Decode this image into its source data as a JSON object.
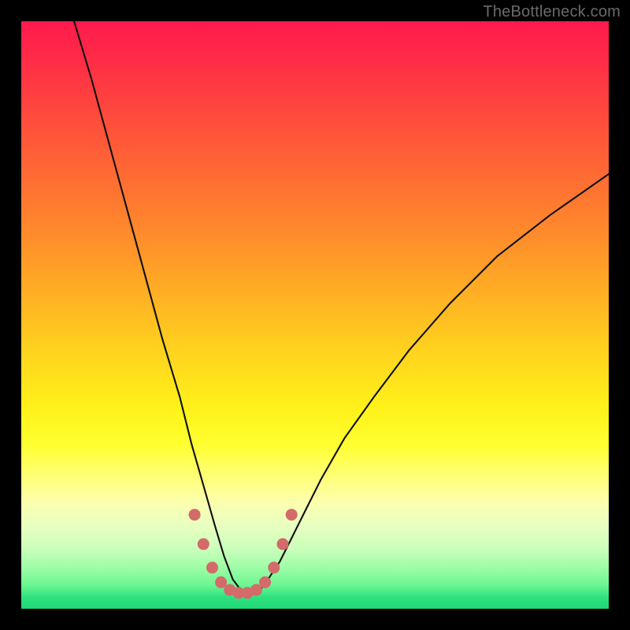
{
  "watermark": {
    "text": "TheBottleneck.com"
  },
  "colors": {
    "frame": "#000000",
    "curve_stroke": "#0f0f0f",
    "marker_fill": "#d46a6a",
    "gradient_stops": [
      "#ff1a4d",
      "#ff2a47",
      "#ff4a3d",
      "#ff6a33",
      "#ff8a2b",
      "#ffae24",
      "#ffd21e",
      "#fff21a",
      "#ffff30",
      "#ffff7d",
      "#fbffb0",
      "#e7ffc0",
      "#c8ffba",
      "#9dfda6",
      "#6cf591",
      "#2fe27e",
      "#1fd877"
    ]
  },
  "chart_data": {
    "type": "line",
    "title": "",
    "xlabel": "",
    "ylabel": "",
    "xlim": [
      0,
      100
    ],
    "ylim": [
      0,
      100
    ],
    "grid": false,
    "legend": false,
    "series": [
      {
        "name": "bottleneck-curve",
        "x": [
          9,
          12,
          15,
          18,
          21,
          24,
          27,
          29,
          31,
          33,
          34.5,
          36,
          37.5,
          39,
          40.5,
          42,
          44,
          46,
          48,
          51,
          55,
          60,
          66,
          73,
          81,
          90,
          100
        ],
        "y": [
          100,
          90,
          79,
          68,
          57,
          46,
          36,
          28,
          21,
          14,
          9,
          5,
          3,
          2.5,
          3,
          5,
          8,
          12,
          16,
          22,
          29,
          36,
          44,
          52,
          60,
          67,
          74
        ]
      }
    ],
    "markers": {
      "name": "highlight-dots",
      "x": [
        29.5,
        31.0,
        32.5,
        34.0,
        35.5,
        37.0,
        38.5,
        40.0,
        41.5,
        43.0,
        44.5,
        46.0
      ],
      "y": [
        16.0,
        11.0,
        7.0,
        4.5,
        3.2,
        2.7,
        2.7,
        3.2,
        4.5,
        7.0,
        11.0,
        16.0
      ]
    }
  }
}
